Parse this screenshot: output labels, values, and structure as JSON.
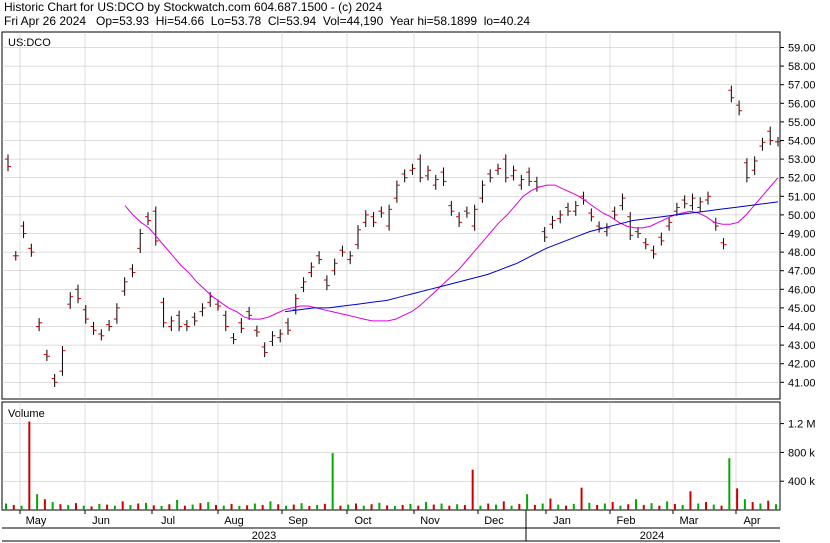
{
  "header": {
    "line1": "Historic Chart for US:DCO by Stockwatch.com 604.687.1500 - (c) 2024",
    "line2": "Fri Apr 26 2024   Op=53.93  Hi=54.66  Lo=53.78  Cl=53.94  Vol=44,190  Year hi=58.1899  lo=40.24"
  },
  "colors": {
    "up_bar": "#00aa00",
    "down_bar": "#cc0000",
    "price_bar": "#000000",
    "ma_short": "#dd00dd",
    "ma_long": "#0000cc",
    "grid": "#bbbbbb"
  },
  "chart_data": [
    {
      "type": "line",
      "title": "US:DCO",
      "ylim": [
        40.24,
        58.1899
      ],
      "yticks": [
        "41.00",
        "42.00",
        "43.00",
        "44.00",
        "45.00",
        "46.00",
        "47.00",
        "48.00",
        "49.00",
        "50.00",
        "51.00",
        "52.00",
        "53.00",
        "54.00",
        "55.00",
        "56.00",
        "57.00",
        "58.00",
        "59.00"
      ],
      "x_months": [
        "May",
        "Jun",
        "Jul",
        "Aug",
        "Sep",
        "Oct",
        "Nov",
        "Dec",
        "Jan",
        "Feb",
        "Mar",
        "Apr"
      ],
      "x_years": [
        "2023",
        "2024"
      ],
      "grid": true,
      "series": [
        {
          "key": "price",
          "values": [
            [
              53.0,
              52.6
            ],
            [
              47.8,
              47.8
            ],
            [
              49.4,
              49.0
            ],
            [
              48.2,
              48.0
            ],
            [
              44.0,
              44.2
            ],
            [
              42.5,
              42.4
            ],
            [
              41.2,
              41.0
            ],
            [
              41.6,
              42.7
            ],
            [
              45.2,
              45.6
            ],
            [
              46.0,
              45.5
            ],
            [
              44.9,
              44.4
            ],
            [
              44.0,
              43.8
            ],
            [
              43.6,
              43.5
            ],
            [
              44.1,
              44.0
            ],
            [
              44.4,
              45.0
            ],
            [
              45.9,
              46.4
            ],
            [
              47.1,
              46.9
            ],
            [
              48.2,
              49.0
            ],
            [
              49.9,
              49.7
            ],
            [
              50.2,
              48.6
            ],
            [
              45.3,
              44.2
            ],
            [
              44.0,
              44.3
            ],
            [
              44.6,
              44.0
            ],
            [
              44.1,
              44.0
            ],
            [
              44.5,
              44.3
            ],
            [
              44.8,
              45.0
            ],
            [
              45.3,
              45.6
            ],
            [
              45.2,
              45.1
            ],
            [
              44.6,
              44.0
            ],
            [
              43.4,
              43.3
            ],
            [
              44.2,
              43.9
            ],
            [
              44.8,
              44.6
            ],
            [
              43.8,
              43.7
            ],
            [
              42.9,
              42.6
            ],
            [
              43.2,
              43.5
            ],
            [
              43.4,
              43.6
            ],
            [
              44.2,
              43.8
            ],
            [
              44.9,
              45.5
            ],
            [
              46.1,
              46.4
            ],
            [
              46.9,
              47.2
            ],
            [
              47.8,
              47.6
            ],
            [
              46.5,
              46.2
            ],
            [
              47.0,
              47.4
            ],
            [
              48.1,
              48.0
            ],
            [
              47.6,
              47.8
            ],
            [
              48.4,
              49.2
            ],
            [
              49.6,
              50.0
            ],
            [
              49.9,
              49.6
            ],
            [
              50.2,
              50.1
            ],
            [
              49.4,
              50.3
            ],
            [
              50.9,
              51.6
            ],
            [
              52.2,
              52.0
            ],
            [
              52.4,
              52.5
            ],
            [
              53.0,
              52.0
            ],
            [
              52.1,
              52.4
            ],
            [
              51.6,
              51.9
            ],
            [
              52.3,
              51.8
            ],
            [
              50.5,
              50.2
            ],
            [
              49.9,
              49.6
            ],
            [
              50.2,
              50.1
            ],
            [
              49.4,
              50.3
            ],
            [
              50.9,
              51.6
            ],
            [
              52.2,
              52.0
            ],
            [
              52.4,
              52.5
            ],
            [
              53.0,
              52.0
            ],
            [
              52.1,
              52.4
            ],
            [
              51.6,
              51.9
            ],
            [
              52.3,
              51.8
            ],
            [
              51.8,
              51.5
            ],
            [
              49.1,
              48.8
            ],
            [
              49.5,
              49.7
            ],
            [
              49.8,
              50.0
            ],
            [
              50.4,
              50.2
            ],
            [
              50.2,
              50.5
            ],
            [
              51.0,
              50.8
            ],
            [
              50.1,
              49.9
            ],
            [
              49.4,
              49.3
            ],
            [
              49.1,
              49.3
            ],
            [
              50.2,
              50.0
            ],
            [
              50.5,
              50.9
            ],
            [
              49.9,
              48.9
            ],
            [
              49.1,
              49.0
            ],
            [
              48.5,
              48.4
            ],
            [
              48.1,
              47.9
            ],
            [
              48.8,
              48.6
            ],
            [
              49.4,
              49.6
            ],
            [
              50.2,
              50.4
            ],
            [
              50.8,
              50.6
            ],
            [
              50.5,
              50.9
            ],
            [
              50.4,
              50.7
            ],
            [
              50.8,
              51.0
            ],
            [
              49.6,
              49.4
            ],
            [
              48.5,
              48.4
            ],
            [
              56.7,
              56.3
            ],
            [
              55.9,
              55.6
            ],
            [
              52.8,
              52.0
            ],
            [
              52.4,
              52.9
            ],
            [
              53.7,
              53.9
            ],
            [
              54.5,
              54.0
            ],
            [
              53.93,
              53.94
            ]
          ]
        },
        {
          "key": "ma_short",
          "name": "",
          "values": [
            50.5,
            50.0,
            49.6,
            49.3,
            48.8,
            48.3,
            47.8,
            47.3,
            46.9,
            46.4,
            46.0,
            45.6,
            45.3,
            45.0,
            44.8,
            44.5,
            44.4,
            44.4,
            44.5,
            44.7,
            44.9,
            45.0,
            45.1,
            45.1,
            45.0,
            44.9,
            44.8,
            44.7,
            44.6,
            44.5,
            44.4,
            44.3,
            44.3,
            44.3,
            44.4,
            44.6,
            44.8,
            45.1,
            45.5,
            45.9,
            46.3,
            46.7,
            47.1,
            47.6,
            48.1,
            48.6,
            49.1,
            49.6,
            50.0,
            50.5,
            51.0,
            51.3,
            51.5,
            51.6,
            51.6,
            51.4,
            51.2,
            51.0,
            50.7,
            50.4,
            50.1,
            49.9,
            49.6,
            49.4,
            49.3,
            49.3,
            49.4,
            49.6,
            49.8,
            50.0,
            50.1,
            50.2,
            50.1,
            49.9,
            49.6,
            49.5,
            49.5,
            49.6,
            50.0,
            50.5,
            51.0,
            51.5,
            52.0
          ]
        },
        {
          "key": "ma_long",
          "name": "",
          "values": [
            44.8,
            44.9,
            45.0,
            45.0,
            45.1,
            45.2,
            45.3,
            45.4,
            45.6,
            45.8,
            46.0,
            46.2,
            46.4,
            46.6,
            46.8,
            47.1,
            47.4,
            47.8,
            48.2,
            48.5,
            48.8,
            49.1,
            49.3,
            49.5,
            49.7,
            49.8,
            49.9,
            50.0,
            50.1,
            50.2,
            50.3,
            50.4,
            50.5,
            50.6,
            50.7
          ]
        }
      ]
    },
    {
      "type": "bar",
      "title": "Volume",
      "yticks": [
        "400 k",
        "800 k",
        "1.2 M"
      ],
      "values": [
        [
          90,
          1
        ],
        [
          70,
          0
        ],
        [
          60,
          1
        ],
        [
          1230,
          0
        ],
        [
          220,
          1
        ],
        [
          150,
          0
        ],
        [
          110,
          1
        ],
        [
          80,
          0
        ],
        [
          70,
          1
        ],
        [
          95,
          0
        ],
        [
          60,
          1
        ],
        [
          50,
          0
        ],
        [
          85,
          1
        ],
        [
          75,
          0
        ],
        [
          60,
          1
        ],
        [
          120,
          0
        ],
        [
          70,
          1
        ],
        [
          90,
          0
        ],
        [
          100,
          1
        ],
        [
          65,
          0
        ],
        [
          55,
          1
        ],
        [
          80,
          0
        ],
        [
          140,
          1
        ],
        [
          60,
          0
        ],
        [
          75,
          1
        ],
        [
          95,
          0
        ],
        [
          110,
          1
        ],
        [
          70,
          0
        ],
        [
          60,
          1
        ],
        [
          85,
          0
        ],
        [
          55,
          1
        ],
        [
          65,
          0
        ],
        [
          90,
          1
        ],
        [
          70,
          0
        ],
        [
          120,
          1
        ],
        [
          80,
          0
        ],
        [
          60,
          1
        ],
        [
          75,
          0
        ],
        [
          95,
          1
        ],
        [
          55,
          0
        ],
        [
          70,
          1
        ],
        [
          85,
          0
        ],
        [
          790,
          1
        ],
        [
          60,
          0
        ],
        [
          75,
          1
        ],
        [
          90,
          0
        ],
        [
          60,
          1
        ],
        [
          80,
          0
        ],
        [
          100,
          1
        ],
        [
          65,
          0
        ],
        [
          55,
          1
        ],
        [
          70,
          0
        ],
        [
          85,
          1
        ],
        [
          60,
          0
        ],
        [
          110,
          1
        ],
        [
          75,
          0
        ],
        [
          90,
          1
        ],
        [
          60,
          0
        ],
        [
          80,
          1
        ],
        [
          70,
          0
        ],
        [
          560,
          0
        ],
        [
          60,
          1
        ],
        [
          90,
          0
        ],
        [
          75,
          1
        ],
        [
          120,
          0
        ],
        [
          60,
          1
        ],
        [
          85,
          0
        ],
        [
          220,
          1
        ],
        [
          70,
          0
        ],
        [
          90,
          1
        ],
        [
          160,
          0
        ],
        [
          75,
          1
        ],
        [
          60,
          0
        ],
        [
          85,
          1
        ],
        [
          310,
          0
        ],
        [
          100,
          1
        ],
        [
          70,
          0
        ],
        [
          90,
          1
        ],
        [
          110,
          0
        ],
        [
          60,
          1
        ],
        [
          80,
          0
        ],
        [
          150,
          1
        ],
        [
          70,
          0
        ],
        [
          95,
          1
        ],
        [
          60,
          0
        ],
        [
          120,
          1
        ],
        [
          85,
          0
        ],
        [
          70,
          1
        ],
        [
          260,
          0
        ],
        [
          90,
          1
        ],
        [
          110,
          0
        ],
        [
          75,
          1
        ],
        [
          60,
          0
        ],
        [
          720,
          1
        ],
        [
          300,
          0
        ],
        [
          150,
          1
        ],
        [
          110,
          0
        ],
        [
          90,
          1
        ],
        [
          130,
          0
        ],
        [
          80,
          1
        ]
      ]
    }
  ]
}
